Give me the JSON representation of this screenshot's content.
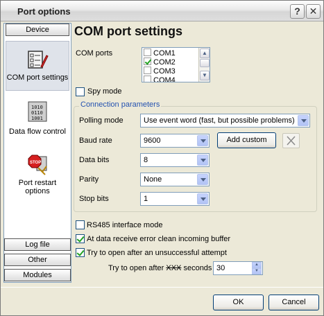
{
  "window": {
    "title": "Port options",
    "help_button": "?",
    "close_button": "✕"
  },
  "nav": {
    "header": "Device",
    "items": [
      {
        "label": "COM port settings",
        "icon": "settings-checklist-icon"
      },
      {
        "label": "Data flow control",
        "icon": "binary-data-icon"
      },
      {
        "label": "Port restart options",
        "icon": "stop-restart-icon"
      }
    ],
    "bottom": [
      "Log file",
      "Other",
      "Modules"
    ]
  },
  "main": {
    "title": "COM port settings",
    "com_ports_label": "COM ports",
    "com_ports": [
      {
        "name": "COM1",
        "checked": false
      },
      {
        "name": "COM2",
        "checked": true
      },
      {
        "name": "COM3",
        "checked": false
      },
      {
        "name": "COM4",
        "checked": false
      }
    ],
    "spy_mode": {
      "label": "Spy mode",
      "checked": false
    },
    "connection": {
      "legend": "Connection parameters",
      "polling_mode": {
        "label": "Polling mode",
        "value": "Use event word (fast, but possible problems)"
      },
      "baud_rate": {
        "label": "Baud rate",
        "value": "9600",
        "add_custom": "Add custom"
      },
      "data_bits": {
        "label": "Data bits",
        "value": "8"
      },
      "parity": {
        "label": "Parity",
        "value": "None"
      },
      "stop_bits": {
        "label": "Stop bits",
        "value": "1"
      }
    },
    "rs485": {
      "label": "RS485 interface mode",
      "checked": false
    },
    "clean_buffer": {
      "label": "At data receive error clean incoming buffer",
      "checked": true
    },
    "retry_open": {
      "label": "Try to open after an unsuccessful attempt",
      "checked": true
    },
    "retry_seconds": {
      "label_before": "Try to open after",
      "label_mid": "XXX",
      "label_after": "seconds",
      "value": "30"
    }
  },
  "footer": {
    "ok": "OK",
    "cancel": "Cancel"
  }
}
